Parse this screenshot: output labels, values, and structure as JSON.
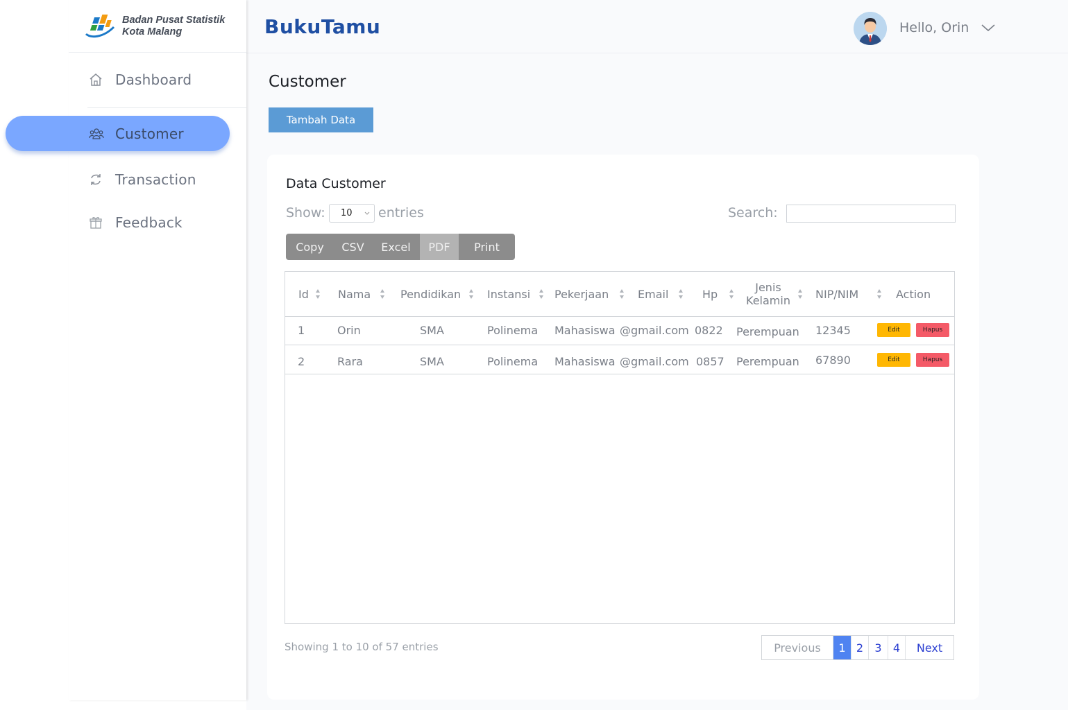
{
  "brand": {
    "line1": "Badan Pusat Statistik",
    "line2": "Kota Malang"
  },
  "app_title": "BukuTamu",
  "user": {
    "greeting": "Hello, Orin"
  },
  "sidebar": {
    "items": [
      {
        "label": "Dashboard",
        "icon": "home-icon"
      },
      {
        "label": "Customer",
        "icon": "users-icon",
        "active": true
      },
      {
        "label": "Transaction",
        "icon": "transaction-icon"
      },
      {
        "label": "Feedback",
        "icon": "feedback-icon"
      }
    ]
  },
  "page": {
    "title": "Customer",
    "add_button": "Tambah Data"
  },
  "card": {
    "title": "Data Customer",
    "show_label": "Show:",
    "entries_value": "10",
    "entries_label": "entries",
    "search_label": "Search:",
    "search_value": ""
  },
  "export_buttons": [
    "Copy",
    "CSV",
    "Excel",
    "PDF",
    "Print"
  ],
  "export_active": "PDF",
  "table": {
    "columns": [
      "Id",
      "Nama",
      "Pendidikan",
      "Instansi",
      "Pekerjaan",
      "Email",
      "Hp",
      "Jenis",
      "Kelamin",
      "NIP/NIM",
      "Action"
    ],
    "rows": [
      {
        "id": "1",
        "nama": "Orin",
        "pendidikan": "SMA",
        "instansi": "Polinema",
        "pekerjaan": "Mahasiswa",
        "email": "@gmail.com",
        "hp": "0822",
        "jenis_kelamin": "Perempuan",
        "nip": "12345"
      },
      {
        "id": "2",
        "nama": "Rara",
        "pendidikan": "SMA",
        "instansi": "Polinema",
        "pekerjaan": "Mahasiswa",
        "email": "@gmail.com",
        "hp": "0857",
        "jenis_kelamin": "Perempuan",
        "nip": "67890"
      }
    ],
    "edit_label": "Edit",
    "delete_label": "Hapus"
  },
  "footer": {
    "info": "Showing 1 to 10 of 57 entries",
    "pagination": {
      "previous": "Previous",
      "pages": [
        "1",
        "2",
        "3",
        "4"
      ],
      "current": "1",
      "next": "Next"
    }
  },
  "colors": {
    "accent": "#7aa7ff",
    "title_blue": "#1f4fa3",
    "add_button": "#5b9bd5",
    "edit": "#ffb703",
    "delete": "#f45a67",
    "page_active": "#4f83f1"
  }
}
